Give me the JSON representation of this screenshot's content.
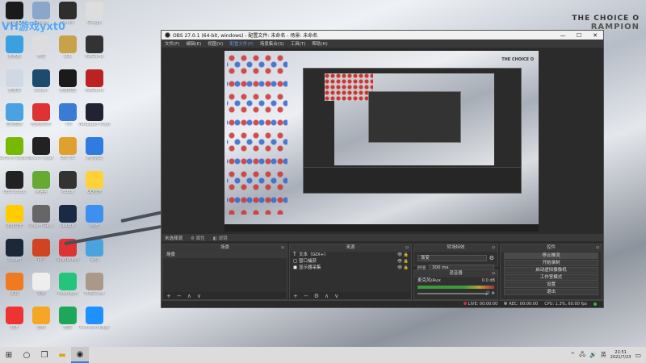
{
  "watermark": "VH游戏yxt0",
  "desktop": {
    "icons": [
      {
        "label": "腾讯QQ",
        "color": "#1a1a1a"
      },
      {
        "label": "Ubisoft",
        "color": "#8aa6c9"
      },
      {
        "label": "Nvidia",
        "color": "#2e2e2e"
      },
      {
        "label": "Google",
        "color": "#ddd"
      },
      {
        "label": "Internet Explorer",
        "color": "#1e88e5"
      },
      {
        "label": "此电脑",
        "color": "#3aa0e0"
      },
      {
        "label": "微信",
        "color": "#ddd"
      },
      {
        "label": "LOL",
        "color": "#c8a24a"
      },
      {
        "label": "WeGame",
        "color": "#333"
      },
      {
        "label": "Edge",
        "color": "#3399ff"
      },
      {
        "label": "回收站",
        "color": "#cfd8e3"
      },
      {
        "label": "Steam",
        "color": "#1e4a6e"
      },
      {
        "label": "英雄联盟",
        "color": "#1a1a1a"
      },
      {
        "label": "WeGame",
        "color": "#b22"
      },
      {
        "label": "Microsoft",
        "color": "#eee"
      },
      {
        "label": "控制面板",
        "color": "#4aa3df"
      },
      {
        "label": "网易云音乐",
        "color": "#d33"
      },
      {
        "label": "飞书",
        "color": "#3a7bd5"
      },
      {
        "label": "Wallpaper Engine",
        "color": "#223"
      },
      {
        "label": "Word",
        "color": "#eee"
      },
      {
        "label": "GeForce Experience",
        "color": "#76b900"
      },
      {
        "label": "Steam Apps",
        "color": "#222"
      },
      {
        "label": "QQ飞车",
        "color": "#e0a030"
      },
      {
        "label": "腾讯会议",
        "color": "#2f7be0"
      },
      {
        "label": "微信读书",
        "color": "#ff7a1a"
      },
      {
        "label": "OBS Studio",
        "color": "#222"
      },
      {
        "label": "易语言",
        "color": "#6a3"
      },
      {
        "label": "Puzzle",
        "color": "#333"
      },
      {
        "label": "QQ音乐",
        "color": "#ffd23a"
      },
      {
        "label": "Among Us",
        "color": "#c33"
      },
      {
        "label": "酷我音乐",
        "color": "#fc0"
      },
      {
        "label": "Steam Gear",
        "color": "#666"
      },
      {
        "label": "League",
        "color": "#1b2a44"
      },
      {
        "label": "网盘",
        "color": "#3d90f0"
      },
      {
        "label": "Stardew",
        "color": "#2a3bb0"
      },
      {
        "label": "Steam",
        "color": "#1b2838"
      },
      {
        "label": "PPT",
        "color": "#d04423"
      },
      {
        "label": "SolidWorks",
        "color": "#d33"
      },
      {
        "label": "桌面",
        "color": "#4aa3df"
      },
      {
        "label": "微信",
        "color": "#2aae67"
      },
      {
        "label": "工具",
        "color": "#f07a20"
      },
      {
        "label": "文档",
        "color": "#eee"
      },
      {
        "label": "Moonlight",
        "color": "#24c47a"
      },
      {
        "label": "PUBG Lite",
        "color": "#a98"
      },
      {
        "label": "资源",
        "color": "#ddd"
      },
      {
        "label": "程序",
        "color": "#e33"
      },
      {
        "label": "游戏",
        "color": "#f5a623"
      },
      {
        "label": "微信",
        "color": "#1ea75a"
      },
      {
        "label": "Microsoft Edge",
        "color": "#1e90ff"
      }
    ]
  },
  "rog": {
    "line1": "THE CHOICE O",
    "line2": "RAMPION"
  },
  "obs": {
    "title": "OBS 27.0.1 (64-bit, windows) - 配置文件: 未命名 - 场景: 未命名",
    "controls": {
      "min": "—",
      "max": "☐",
      "close": "✕"
    },
    "menu": [
      "文件(F)",
      "编辑(E)",
      "视图(V)",
      "配置文件(P)",
      "场景集合(S)",
      "工具(T)",
      "帮助(H)"
    ],
    "preview": {
      "rog": "THE CHOICE O"
    },
    "source_bar": {
      "label": "未选择源",
      "props": "属性",
      "filters": "滤镜"
    },
    "scenes": {
      "title": "场景",
      "items": [
        "场景"
      ],
      "foot": [
        "+",
        "−",
        "∧",
        "∨"
      ]
    },
    "sources": {
      "title": "来源",
      "items": [
        {
          "icon": "T",
          "label": "文本（GDI+）"
        },
        {
          "icon": "◻",
          "label": "窗口捕获"
        },
        {
          "icon": "◼",
          "label": "显示器采集"
        }
      ],
      "foot": [
        "+",
        "−",
        "⚙",
        "∧",
        "∨"
      ]
    },
    "transitions": {
      "title": "转场特效",
      "type": "渐变",
      "duration_label": "时长",
      "duration": "300 ms"
    },
    "mixer": {
      "title": "混音器",
      "channel": "麦克风/Aux",
      "level": "0.0 dB"
    },
    "controls_dock": {
      "title": "控件",
      "buttons": [
        "停止推流",
        "开始录制",
        "启动虚拟摄像机",
        "工作室模式",
        "设置",
        "退出"
      ]
    },
    "status": {
      "live_label": "LIVE:",
      "live": "00:00:00",
      "rec_label": "REC:",
      "rec": "00:00:00",
      "cpu": "CPU: 1.3%, 60.00 fps"
    }
  },
  "taskbar": {
    "time": "22:51",
    "date": "2021/7/23",
    "tray": [
      "^",
      "🖧",
      "🔊",
      "英"
    ]
  }
}
